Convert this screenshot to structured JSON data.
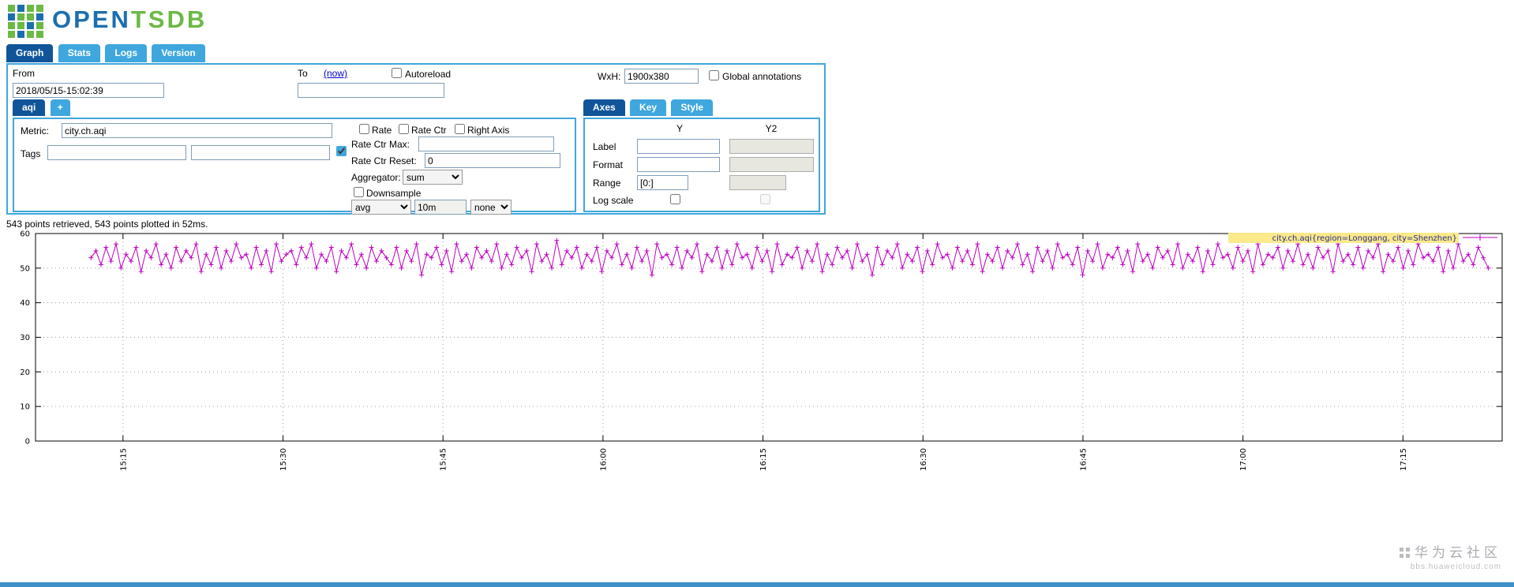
{
  "logo": {
    "open": "OPEN",
    "tsdb": "TSDB"
  },
  "nav_tabs": [
    {
      "label": "Graph",
      "active": true
    },
    {
      "label": "Stats",
      "active": false
    },
    {
      "label": "Logs",
      "active": false
    },
    {
      "label": "Version",
      "active": false
    }
  ],
  "query_form": {
    "from": {
      "label": "From",
      "value": "2018/05/15-15:02:39"
    },
    "to": {
      "label": "To",
      "now_link": "(now)",
      "autoreload_label": "Autoreload",
      "value": ""
    },
    "wxh": {
      "label": "WxH:",
      "value": "1900x380"
    },
    "global_annotations_label": "Global annotations",
    "metric_tabs": {
      "active": "aqi",
      "add": "+"
    },
    "metric": {
      "metric_label": "Metric:",
      "metric_value": "city.ch.aqi",
      "tags_label": "Tags",
      "tag_key_value": "",
      "tag_value_value": "",
      "rate_label": "Rate",
      "rate_ctr_label": "Rate Ctr",
      "right_axis_label": "Right Axis",
      "rate_ctr_max_label": "Rate Ctr Max:",
      "rate_ctr_max_value": "",
      "rate_ctr_reset_label": "Rate Ctr Reset:",
      "rate_ctr_reset_value": "0",
      "aggregator_label": "Aggregator:",
      "aggregator_value": "sum",
      "downsample_label": "Downsample",
      "downsample_agg": "avg",
      "downsample_interval": "10m",
      "downsample_fill": "none"
    },
    "axes_panel": {
      "tabs": [
        {
          "label": "Axes",
          "active": true
        },
        {
          "label": "Key",
          "active": false
        },
        {
          "label": "Style",
          "active": false
        }
      ],
      "col_y": "Y",
      "col_y2": "Y2",
      "row_label": "Label",
      "row_format": "Format",
      "row_range": "Range",
      "row_log": "Log scale",
      "label_y_value": "",
      "format_y_value": "",
      "range_y_value": "[0:]",
      "label_y2_value": "",
      "format_y2_value": "",
      "range_y2_value": ""
    },
    "checkbox_states": {
      "autoreload": false,
      "global_annotations": false,
      "tags": true,
      "rate": false,
      "rate_ctr": false,
      "right_axis": false,
      "downsample": false,
      "log_y": false,
      "log_y2": false
    }
  },
  "status_line": "543 points retrieved, 543 points plotted in 52ms.",
  "chart_data": {
    "type": "line",
    "title": "",
    "legend_label": "city.ch.aqi{region=Longgang, city=Shenzhen}",
    "series_color": "#c000c0",
    "marker": "plus",
    "grid": true,
    "legend_position": "top-right-inside",
    "ylim": [
      0,
      60
    ],
    "yticks": [
      0,
      10,
      20,
      30,
      40,
      50,
      60
    ],
    "x_domain_minutes_after_1500": [
      6.8,
      144.3
    ],
    "xticks": [
      {
        "label": "15:15",
        "min": 15
      },
      {
        "label": "15:30",
        "min": 30
      },
      {
        "label": "15:45",
        "min": 45
      },
      {
        "label": "16:00",
        "min": 60
      },
      {
        "label": "16:15",
        "min": 75
      },
      {
        "label": "16:30",
        "min": 90
      },
      {
        "label": "16:45",
        "min": 105
      },
      {
        "label": "17:00",
        "min": 120
      },
      {
        "label": "17:15",
        "min": 135
      }
    ],
    "points_x_start_min": 12,
    "points_x_end_min": 143,
    "values": [
      53,
      55,
      51,
      56,
      52,
      57,
      50,
      54,
      52,
      56,
      49,
      55,
      53,
      57,
      51,
      54,
      50,
      56,
      52,
      55,
      53,
      57,
      49,
      54,
      51,
      56,
      50,
      55,
      52,
      57,
      53,
      54,
      50,
      56,
      51,
      55,
      49,
      57,
      52,
      54,
      55,
      51,
      56,
      53,
      57,
      50,
      54,
      52,
      56,
      49,
      55,
      53,
      57,
      51,
      54,
      50,
      56,
      52,
      55,
      53,
      51,
      56,
      50,
      55,
      52,
      57,
      48,
      54,
      53,
      56,
      51,
      55,
      49,
      57,
      52,
      54,
      50,
      56,
      53,
      55,
      52,
      57,
      50,
      54,
      51,
      56,
      53,
      55,
      49,
      57,
      52,
      54,
      50,
      58,
      51,
      55,
      53,
      56,
      50,
      54,
      52,
      56,
      49,
      55,
      53,
      57,
      51,
      54,
      50,
      56,
      52,
      55,
      48,
      57,
      53,
      54,
      51,
      56,
      50,
      55,
      53,
      57,
      49,
      54,
      52,
      56,
      50,
      55,
      51,
      57,
      53,
      54,
      50,
      56,
      52,
      55,
      49,
      57,
      51,
      54,
      53,
      56,
      50,
      55,
      52,
      57,
      49,
      54,
      51,
      56,
      53,
      55,
      50,
      57,
      52,
      54,
      48,
      56,
      51,
      55,
      53,
      57,
      50,
      54,
      52,
      56,
      49,
      55,
      51,
      57,
      53,
      54,
      50,
      56,
      52,
      55,
      51,
      57,
      49,
      54,
      52,
      56,
      50,
      55,
      53,
      57,
      51,
      54,
      49,
      56,
      52,
      55,
      50,
      57,
      53,
      54,
      51,
      56,
      48,
      55,
      52,
      57,
      50,
      54,
      53,
      56,
      51,
      55,
      49,
      57,
      52,
      54,
      50,
      56,
      53,
      55,
      51,
      57,
      50,
      54,
      52,
      56,
      49,
      55,
      51,
      57,
      53,
      54,
      50,
      56,
      52,
      55,
      49,
      57,
      51,
      54,
      53,
      56,
      50,
      55,
      52,
      57,
      51,
      54,
      50,
      56,
      53,
      55,
      49,
      57,
      52,
      54,
      51,
      56,
      50,
      55,
      53,
      57,
      49,
      54,
      52,
      56,
      50,
      55,
      51,
      57,
      53,
      54,
      52,
      56,
      49,
      55,
      50,
      57,
      52,
      54,
      51,
      56,
      53,
      50
    ]
  },
  "watermark": {
    "title": "华为云社区",
    "subtitle": "bbs.huaweicloud.com"
  }
}
